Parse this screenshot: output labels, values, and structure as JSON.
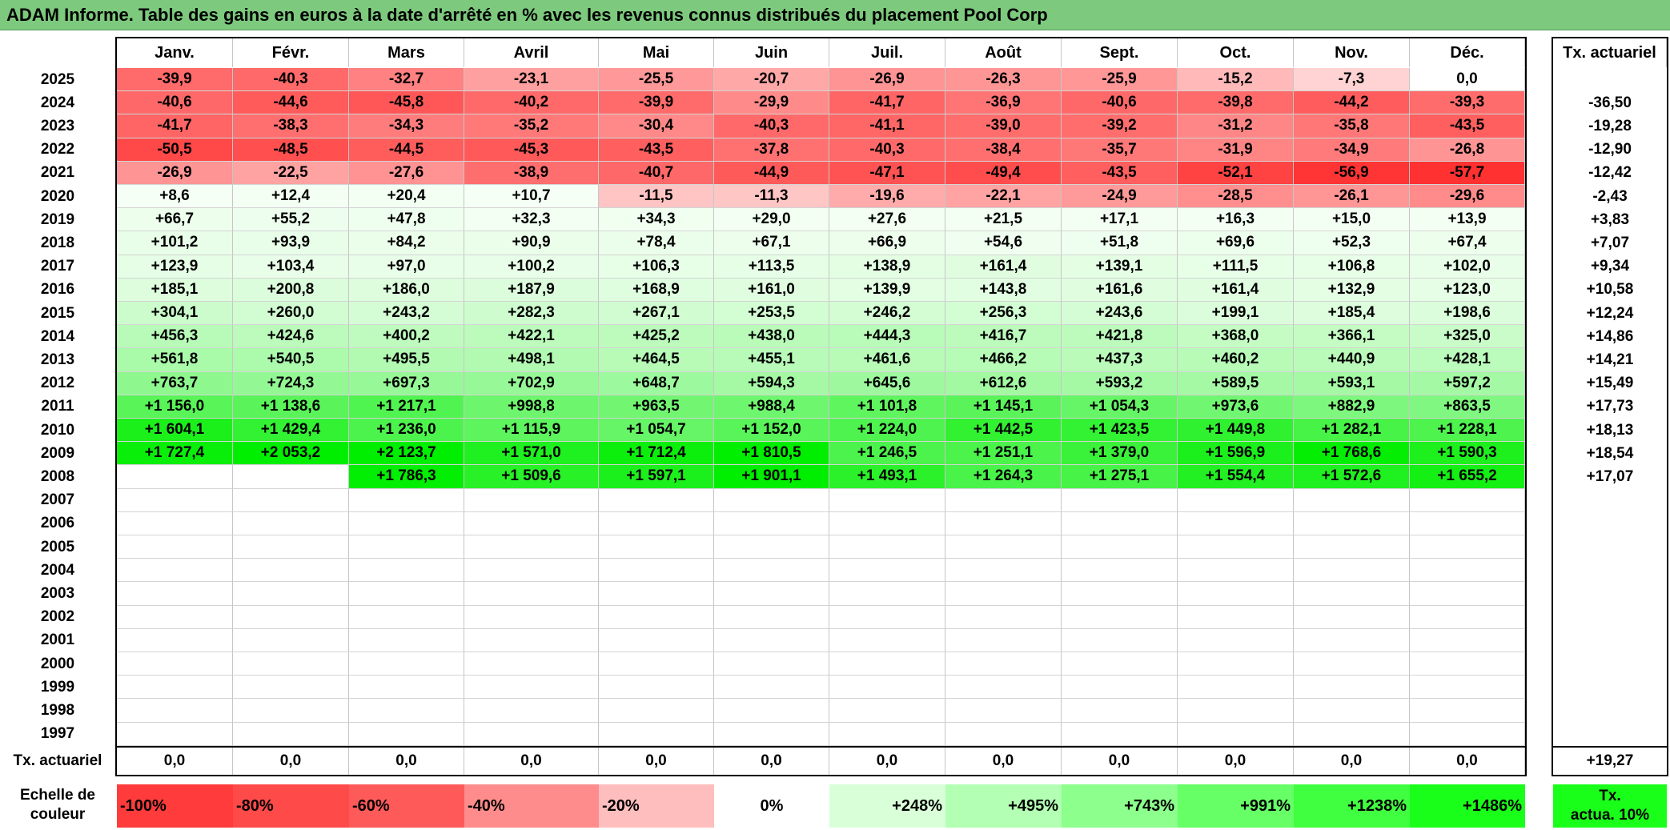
{
  "title": "ADAM Informe. Table des gains en euros à la date d'arrêté en % avec les revenus connus distribués du placement Pool Corp",
  "months": [
    "Janv.",
    "Févr.",
    "Mars",
    "Avril",
    "Mai",
    "Juin",
    "Juil.",
    "Août",
    "Sept.",
    "Oct.",
    "Nov.",
    "Déc."
  ],
  "tx_header": "Tx. actuariel",
  "years": [
    "2025",
    "2024",
    "2023",
    "2022",
    "2021",
    "2020",
    "2019",
    "2018",
    "2017",
    "2016",
    "2015",
    "2014",
    "2013",
    "2012",
    "2011",
    "2010",
    "2009",
    "2008",
    "2007",
    "2006",
    "2005",
    "2004",
    "2003",
    "2002",
    "2001",
    "2000",
    "1999",
    "1998",
    "1997"
  ],
  "values": [
    [
      "-39,9",
      "-40,3",
      "-32,7",
      "-23,1",
      "-25,5",
      "-20,7",
      "-26,9",
      "-26,3",
      "-25,9",
      "-15,2",
      "-7,3",
      "0,0"
    ],
    [
      "-40,6",
      "-44,6",
      "-45,8",
      "-40,2",
      "-39,9",
      "-29,9",
      "-41,7",
      "-36,9",
      "-40,6",
      "-39,8",
      "-44,2",
      "-39,3"
    ],
    [
      "-41,7",
      "-38,3",
      "-34,3",
      "-35,2",
      "-30,4",
      "-40,3",
      "-41,1",
      "-39,0",
      "-39,2",
      "-31,2",
      "-35,8",
      "-43,5"
    ],
    [
      "-50,5",
      "-48,5",
      "-44,5",
      "-45,3",
      "-43,5",
      "-37,8",
      "-40,3",
      "-38,4",
      "-35,7",
      "-31,9",
      "-34,9",
      "-26,8"
    ],
    [
      "-26,9",
      "-22,5",
      "-27,6",
      "-38,9",
      "-40,7",
      "-44,9",
      "-47,1",
      "-49,4",
      "-43,5",
      "-52,1",
      "-56,9",
      "-57,7"
    ],
    [
      "+8,6",
      "+12,4",
      "+20,4",
      "+10,7",
      "-11,5",
      "-11,3",
      "-19,6",
      "-22,1",
      "-24,9",
      "-28,5",
      "-26,1",
      "-29,6"
    ],
    [
      "+66,7",
      "+55,2",
      "+47,8",
      "+32,3",
      "+34,3",
      "+29,0",
      "+27,6",
      "+21,5",
      "+17,1",
      "+16,3",
      "+15,0",
      "+13,9"
    ],
    [
      "+101,2",
      "+93,9",
      "+84,2",
      "+90,9",
      "+78,4",
      "+67,1",
      "+66,9",
      "+54,6",
      "+51,8",
      "+69,6",
      "+52,3",
      "+67,4"
    ],
    [
      "+123,9",
      "+103,4",
      "+97,0",
      "+100,2",
      "+106,3",
      "+113,5",
      "+138,9",
      "+161,4",
      "+139,1",
      "+111,5",
      "+106,8",
      "+102,0"
    ],
    [
      "+185,1",
      "+200,8",
      "+186,0",
      "+187,9",
      "+168,9",
      "+161,0",
      "+139,9",
      "+143,8",
      "+161,6",
      "+161,4",
      "+132,9",
      "+123,0"
    ],
    [
      "+304,1",
      "+260,0",
      "+243,2",
      "+282,3",
      "+267,1",
      "+253,5",
      "+246,2",
      "+256,3",
      "+243,6",
      "+199,1",
      "+185,4",
      "+198,6"
    ],
    [
      "+456,3",
      "+424,6",
      "+400,2",
      "+422,1",
      "+425,2",
      "+438,0",
      "+444,3",
      "+416,7",
      "+421,8",
      "+368,0",
      "+366,1",
      "+325,0"
    ],
    [
      "+561,8",
      "+540,5",
      "+495,5",
      "+498,1",
      "+464,5",
      "+455,1",
      "+461,6",
      "+466,2",
      "+437,3",
      "+460,2",
      "+440,9",
      "+428,1"
    ],
    [
      "+763,7",
      "+724,3",
      "+697,3",
      "+702,9",
      "+648,7",
      "+594,3",
      "+645,6",
      "+612,6",
      "+593,2",
      "+589,5",
      "+593,1",
      "+597,2"
    ],
    [
      "+1 156,0",
      "+1 138,6",
      "+1 217,1",
      "+998,8",
      "+963,5",
      "+988,4",
      "+1 101,8",
      "+1 145,1",
      "+1 054,3",
      "+973,6",
      "+882,9",
      "+863,5"
    ],
    [
      "+1 604,1",
      "+1 429,4",
      "+1 236,0",
      "+1 115,9",
      "+1 054,7",
      "+1 152,0",
      "+1 224,0",
      "+1 442,5",
      "+1 423,5",
      "+1 449,8",
      "+1 282,1",
      "+1 228,1"
    ],
    [
      "+1 727,4",
      "+2 053,2",
      "+2 123,7",
      "+1 571,0",
      "+1 712,4",
      "+1 810,5",
      "+1 246,5",
      "+1 251,1",
      "+1 379,0",
      "+1 596,9",
      "+1 768,6",
      "+1 590,3"
    ],
    [
      "",
      "",
      "+1 786,3",
      "+1 509,6",
      "+1 597,1",
      "+1 901,1",
      "+1 493,1",
      "+1 264,3",
      "+1 275,1",
      "+1 554,4",
      "+1 572,6",
      "+1 655,2"
    ],
    [
      "",
      "",
      "",
      "",
      "",
      "",
      "",
      "",
      "",
      "",
      "",
      ""
    ],
    [
      "",
      "",
      "",
      "",
      "",
      "",
      "",
      "",
      "",
      "",
      "",
      ""
    ],
    [
      "",
      "",
      "",
      "",
      "",
      "",
      "",
      "",
      "",
      "",
      "",
      ""
    ],
    [
      "",
      "",
      "",
      "",
      "",
      "",
      "",
      "",
      "",
      "",
      "",
      ""
    ],
    [
      "",
      "",
      "",
      "",
      "",
      "",
      "",
      "",
      "",
      "",
      "",
      ""
    ],
    [
      "",
      "",
      "",
      "",
      "",
      "",
      "",
      "",
      "",
      "",
      "",
      ""
    ],
    [
      "",
      "",
      "",
      "",
      "",
      "",
      "",
      "",
      "",
      "",
      "",
      ""
    ],
    [
      "",
      "",
      "",
      "",
      "",
      "",
      "",
      "",
      "",
      "",
      "",
      ""
    ],
    [
      "",
      "",
      "",
      "",
      "",
      "",
      "",
      "",
      "",
      "",
      "",
      ""
    ],
    [
      "",
      "",
      "",
      "",
      "",
      "",
      "",
      "",
      "",
      "",
      "",
      ""
    ],
    [
      "",
      "",
      "",
      "",
      "",
      "",
      "",
      "",
      "",
      "",
      "",
      ""
    ]
  ],
  "tx_values": [
    "",
    "-36,50",
    "-19,28",
    "-12,90",
    "-12,42",
    "-2,43",
    "+3,83",
    "+7,07",
    "+9,34",
    "+10,58",
    "+12,24",
    "+14,86",
    "+14,21",
    "+15,49",
    "+17,73",
    "+18,13",
    "+18,54",
    "+17,07",
    "",
    "",
    "",
    "",
    "",
    "",
    "",
    "",
    "",
    "",
    ""
  ],
  "footer": {
    "label": "Tx. actuariel",
    "values": [
      "0,0",
      "0,0",
      "0,0",
      "0,0",
      "0,0",
      "0,0",
      "0,0",
      "0,0",
      "0,0",
      "0,0",
      "0,0",
      "0,0"
    ],
    "total": "+19,27"
  },
  "scale": {
    "label_line1": "Echelle de",
    "label_line2": "couleur",
    "items": [
      {
        "text": "-100%",
        "color": "#ff3b3b",
        "align": "left"
      },
      {
        "text": "-80%",
        "color": "#ff4a4a",
        "align": "left"
      },
      {
        "text": "-60%",
        "color": "#ff5a5a",
        "align": "left"
      },
      {
        "text": "-40%",
        "color": "#ff8c8c",
        "align": "left"
      },
      {
        "text": "-20%",
        "color": "#ffbebe",
        "align": "left"
      },
      {
        "text": "0%",
        "color": "#ffffff",
        "align": "center"
      },
      {
        "text": "+248%",
        "color": "#d9ffd9",
        "align": "right"
      },
      {
        "text": "+495%",
        "color": "#b3ffb3",
        "align": "right"
      },
      {
        "text": "+743%",
        "color": "#8cff8c",
        "align": "right"
      },
      {
        "text": "+991%",
        "color": "#66ff66",
        "align": "right"
      },
      {
        "text": "+1238%",
        "color": "#40ff40",
        "align": "right"
      },
      {
        "text": "+1486%",
        "color": "#1aff1a",
        "align": "right"
      }
    ],
    "tx_line1": "Tx.",
    "tx_line2": "actua. 10%",
    "tx_color": "#1aff1a"
  }
}
